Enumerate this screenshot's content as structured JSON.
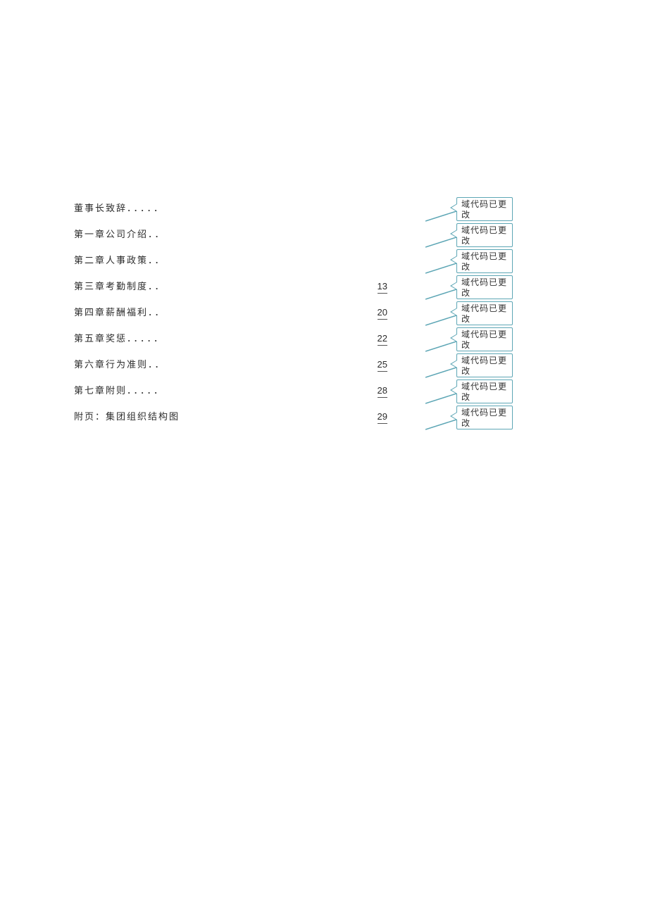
{
  "toc": {
    "entries": [
      {
        "title": "董事长致辞",
        "dots": "．．．．．",
        "page": ""
      },
      {
        "title": "第一章公司介绍",
        "dots": "．．",
        "page": ""
      },
      {
        "title": "第二章人事政策",
        "dots": "．．",
        "page": ""
      },
      {
        "title": "第三章考勤制度",
        "dots": "．．",
        "page": "13"
      },
      {
        "title": "第四章薪酬福利",
        "dots": "．．",
        "page": "20"
      },
      {
        "title": "第五章奖惩",
        "dots": "．．．．．",
        "page": "22"
      },
      {
        "title": "第六章行为准则",
        "dots": "．．",
        "page": "25"
      },
      {
        "title": "第七章附则",
        "dots": "．．．．．",
        "page": "28"
      },
      {
        "title": "附页：集团组织结构图",
        "dots": "",
        "page": "29"
      }
    ]
  },
  "comments": {
    "text": "域代码已更改",
    "line_color": "#5da6b5"
  }
}
